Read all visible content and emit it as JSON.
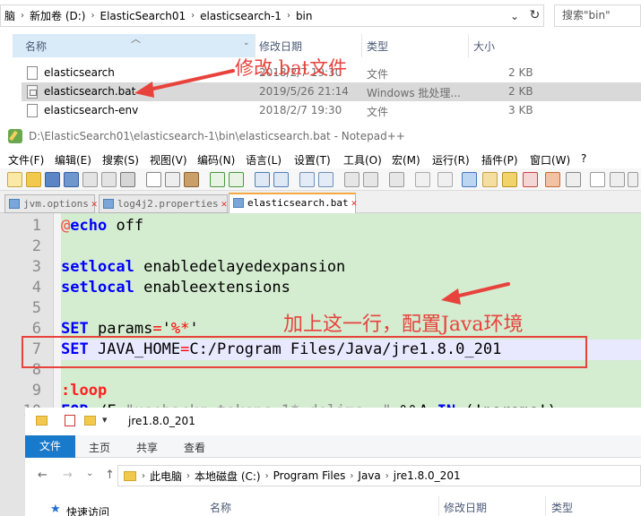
{
  "top_explorer": {
    "breadcrumb": [
      "脑",
      "新加卷 (D:)",
      "ElasticSearch01",
      "elasticsearch-1",
      "bin"
    ],
    "search_placeholder": "搜索\"bin\"",
    "columns": {
      "name": "名称",
      "modified": "修改日期",
      "type": "类型",
      "size": "大小"
    },
    "files": [
      {
        "name": "elasticsearch",
        "modified": "2018/2/7 19:30",
        "type": "文件",
        "size": "2 KB",
        "selected": false,
        "icon": "file-icon"
      },
      {
        "name": "elasticsearch.bat",
        "modified": "2019/5/26 21:14",
        "type": "Windows 批处理...",
        "size": "2 KB",
        "selected": true,
        "icon": "batch-file-icon"
      },
      {
        "name": "elasticsearch-env",
        "modified": "2018/2/7 19:30",
        "type": "文件",
        "size": "3 KB",
        "selected": false,
        "icon": "file-icon"
      }
    ]
  },
  "annotations": {
    "modify_bat": "修改.bat文件",
    "add_line": "加上这一行，配置Java环境",
    "color": "#e8423c"
  },
  "notepad": {
    "title": "D:\\ElasticSearch01\\elasticsearch-1\\bin\\elasticsearch.bat - Notepad++",
    "menu": [
      "文件(F)",
      "编辑(E)",
      "搜索(S)",
      "视图(V)",
      "编码(N)",
      "语言(L)",
      "设置(T)",
      "工具(O)",
      "宏(M)",
      "运行(R)",
      "插件(P)",
      "窗口(W)",
      "?"
    ],
    "tabs": [
      {
        "label": "jvm.options",
        "active": false
      },
      {
        "label": "log4j2.properties",
        "active": false
      },
      {
        "label": "elasticsearch.bat",
        "active": true
      }
    ],
    "lines": [
      {
        "num": "1",
        "parts": [
          {
            "c": "at",
            "t": "@"
          },
          {
            "c": "kw",
            "t": "echo"
          },
          {
            "c": "",
            "t": " off"
          }
        ]
      },
      {
        "num": "2",
        "parts": []
      },
      {
        "num": "3",
        "parts": [
          {
            "c": "kw",
            "t": "setlocal"
          },
          {
            "c": "",
            "t": " enabledelayedexpansion"
          }
        ]
      },
      {
        "num": "4",
        "parts": [
          {
            "c": "kw",
            "t": "setlocal"
          },
          {
            "c": "",
            "t": " enableextensions"
          }
        ]
      },
      {
        "num": "5",
        "parts": []
      },
      {
        "num": "6",
        "parts": [
          {
            "c": "kw",
            "t": "SET"
          },
          {
            "c": "",
            "t": " params"
          },
          {
            "c": "op",
            "t": "="
          },
          {
            "c": "",
            "t": "'"
          },
          {
            "c": "op",
            "t": "%*"
          },
          {
            "c": "",
            "t": "'"
          }
        ]
      },
      {
        "num": "7",
        "parts": [
          {
            "c": "kw",
            "t": "SET"
          },
          {
            "c": "",
            "t": " JAVA_HOME"
          },
          {
            "c": "op",
            "t": "="
          },
          {
            "c": "",
            "t": "C:/Program Files/Java/jre1.8.0_201"
          }
        ]
      },
      {
        "num": "8",
        "parts": []
      },
      {
        "num": "9",
        "parts": [
          {
            "c": "lbl",
            "t": ":loop"
          }
        ]
      },
      {
        "num": "10",
        "parts": [
          {
            "c": "kw",
            "t": "FOR"
          },
          {
            "c": "",
            "t": " /F "
          },
          {
            "c": "str",
            "t": "\"usebackq tokens=1* delims= \""
          },
          {
            "c": "",
            "t": " %%A "
          },
          {
            "c": "kw",
            "t": "IN"
          },
          {
            "c": "",
            "t": " (!params!) "
          }
        ]
      }
    ]
  },
  "bottom_explorer": {
    "title": "jre1.8.0_201",
    "ribbon": {
      "file": "文件",
      "home": "主页",
      "share": "共享",
      "view": "查看"
    },
    "breadcrumb": [
      "此电脑",
      "本地磁盘 (C:)",
      "Program Files",
      "Java",
      "jre1.8.0_201"
    ],
    "quick_access": "快速访问",
    "columns": {
      "name": "名称",
      "modified": "修改日期",
      "type": "类型"
    }
  }
}
